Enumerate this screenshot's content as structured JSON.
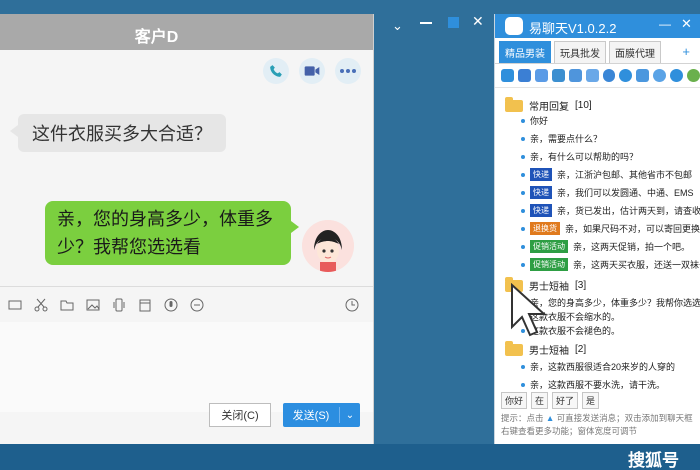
{
  "chat": {
    "title": "客户D",
    "min_glyph": "⌄",
    "incoming": "这件衣服买多大合适？",
    "outgoing": "亲，您的身高多少，体重多少？我帮您选选看",
    "close_label": "关闭(C)",
    "send_label": "发送(S)"
  },
  "panel": {
    "title": "易聊天V1.0.2.2",
    "tabs": [
      "精品男装",
      "玩具批发",
      "面膜代理"
    ],
    "add": "+",
    "groups": [
      {
        "name": "常用回复",
        "count": "[10]"
      },
      {
        "name": "男士短袖",
        "count": "[3]"
      },
      {
        "name": "男士短袖",
        "count": "[2]"
      }
    ],
    "items": [
      {
        "text": "你好"
      },
      {
        "text": "亲，需要点什么？"
      },
      {
        "text": "亲，有什么可以帮助的吗？"
      },
      {
        "tag": "快递",
        "text": "亲，江浙沪包邮、其他省市不包邮"
      },
      {
        "tag": "快递",
        "text": "亲，我们可以发圆通、中通、EMS"
      },
      {
        "tag": "快递",
        "text": "亲，货已发出，估计两天到，请查收"
      },
      {
        "tag": "退换货",
        "text": "亲，如果尺码不对，可以寄回更换"
      },
      {
        "tag": "促销活动",
        "text": "亲，这两天促销，拍一个吧。"
      },
      {
        "tag": "促销活动",
        "text": "亲，这两天买衣服，还送一双袜子"
      },
      {
        "text": "亲，您的身高多少，体重多少？我帮你选选看"
      },
      {
        "text": "这款衣服不会缩水的。"
      },
      {
        "text": "这款衣服不会褪色的。"
      },
      {
        "text": "亲，这款西服很适合20来岁的人穿的"
      },
      {
        "text": "亲，这款西服不要水洗，请干洗。"
      }
    ],
    "quick": [
      "你好",
      "在",
      "好了",
      "是"
    ],
    "hint1": "提示：点击",
    "hint1b": "可直接发送消息；双击添加到聊天框",
    "hint2": "右键查看更多功能；窗体宽度可调节"
  },
  "watermark": "搜狐号",
  "colors": {
    "accent": "#2f8fdc",
    "bubble_out": "#7bcf3f",
    "bubble_in": "#e6e6e6"
  }
}
